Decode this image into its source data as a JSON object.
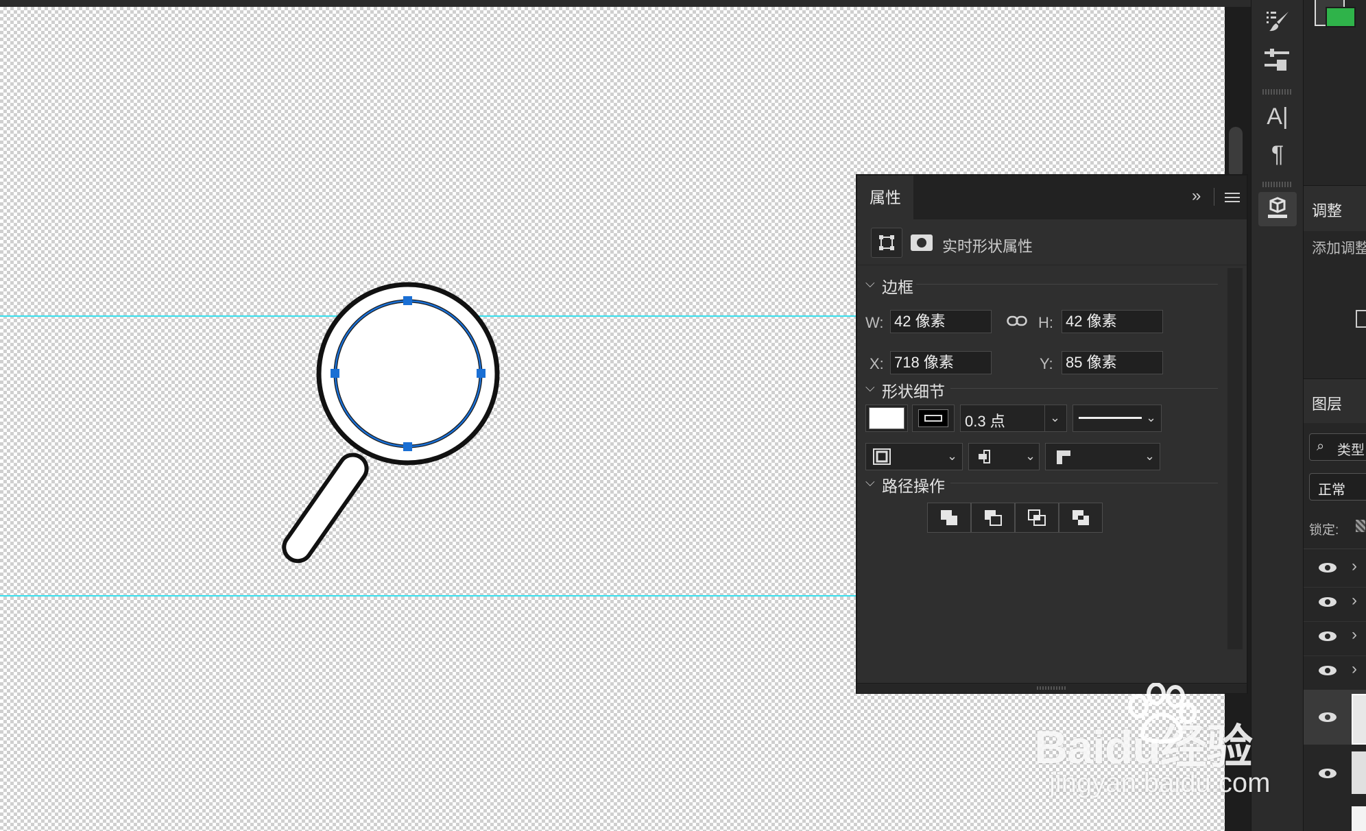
{
  "canvas": {
    "guide_color": "#39e0ee",
    "selection_color": "#1a6fd4"
  },
  "toolstrip": {
    "icons": [
      "brush-settings-icon",
      "adjust-sliders-icon",
      "character-icon",
      "paragraph-icon",
      "3d-icon"
    ],
    "character_glyph": "A|",
    "paragraph_glyph": "¶"
  },
  "properties_panel": {
    "tab_label": "属性",
    "collapse_glyph": "»",
    "subtitle": "实时形状属性",
    "sections": {
      "bounds": "边框",
      "shape_details": "形状细节",
      "path_ops": "路径操作"
    },
    "transform": {
      "w_label": "W:",
      "w_value": "42 像素",
      "h_label": "H:",
      "h_value": "42 像素",
      "x_label": "X:",
      "x_value": "718 像素",
      "y_label": "Y:",
      "y_value": "85 像素"
    },
    "stroke": {
      "width": "0.3 点",
      "fill_color": "#ffffff",
      "stroke_color": "#000000"
    }
  },
  "right_panels": {
    "adjustments_tab": "调整",
    "add_adjustment": "添加调整",
    "layers_tab": "图层",
    "filter_kind": "类型",
    "blend_mode": "正常",
    "lock_label": "锁定:"
  },
  "watermark": {
    "brand": "Baidu经验",
    "url": "jingyan.baidu.com"
  }
}
